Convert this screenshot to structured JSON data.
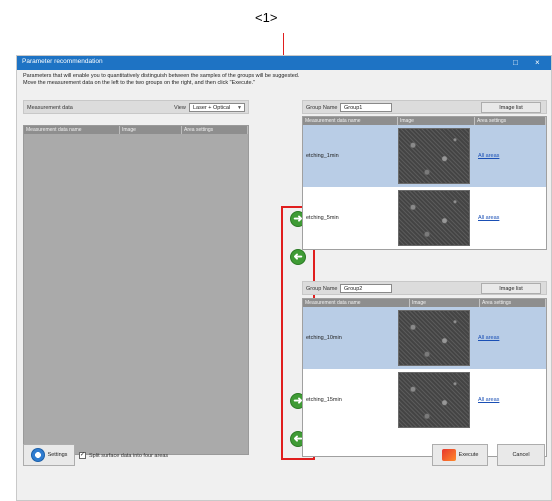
{
  "callout": {
    "label": "<1>"
  },
  "window": {
    "title": "Parameter recommendation",
    "description_line1": "Parameters that will enable you to quantitatively distinguish between the samples of the groups will be suggested.",
    "description_line2": "Move the measurement data on the left to the two groups on the right, and then click \"Execute.\""
  },
  "left_panel": {
    "title": "Measurement data",
    "view_label": "View",
    "view_value": "Laser + Optical",
    "columns": [
      "Measurement data name",
      "Image",
      "Area settings"
    ]
  },
  "groups": [
    {
      "name_label": "Group Name",
      "name_value": "Group1",
      "image_list_label": "Image list",
      "columns": [
        "Measurement data name",
        "Image",
        "Area settings"
      ],
      "rows": [
        {
          "name": "etching_1min",
          "area": "All areas",
          "selected": true
        },
        {
          "name": "etching_5min",
          "area": "All areas",
          "selected": false
        }
      ]
    },
    {
      "name_label": "Group Name",
      "name_value": "Group2",
      "image_list_label": "Image list",
      "columns": [
        "Measurement data name",
        "Image",
        "Area settings"
      ],
      "rows": [
        {
          "name": "etching_10min",
          "area": "All areas",
          "selected": true
        },
        {
          "name": "etching_15min",
          "area": "All areas",
          "selected": false
        }
      ]
    }
  ],
  "arrows": {
    "right": "➜",
    "left": "➜"
  },
  "footer": {
    "settings_label": "Settings",
    "split_label": "Split surface data into four areas",
    "split_checked": "✓",
    "execute_label": "Execute",
    "cancel_label": "Cancel"
  },
  "colors": {
    "titlebar": "#1e73c4",
    "selected_row": "#b9cde6",
    "callout": "#e01e1e",
    "arrow": "#3f9b35"
  }
}
